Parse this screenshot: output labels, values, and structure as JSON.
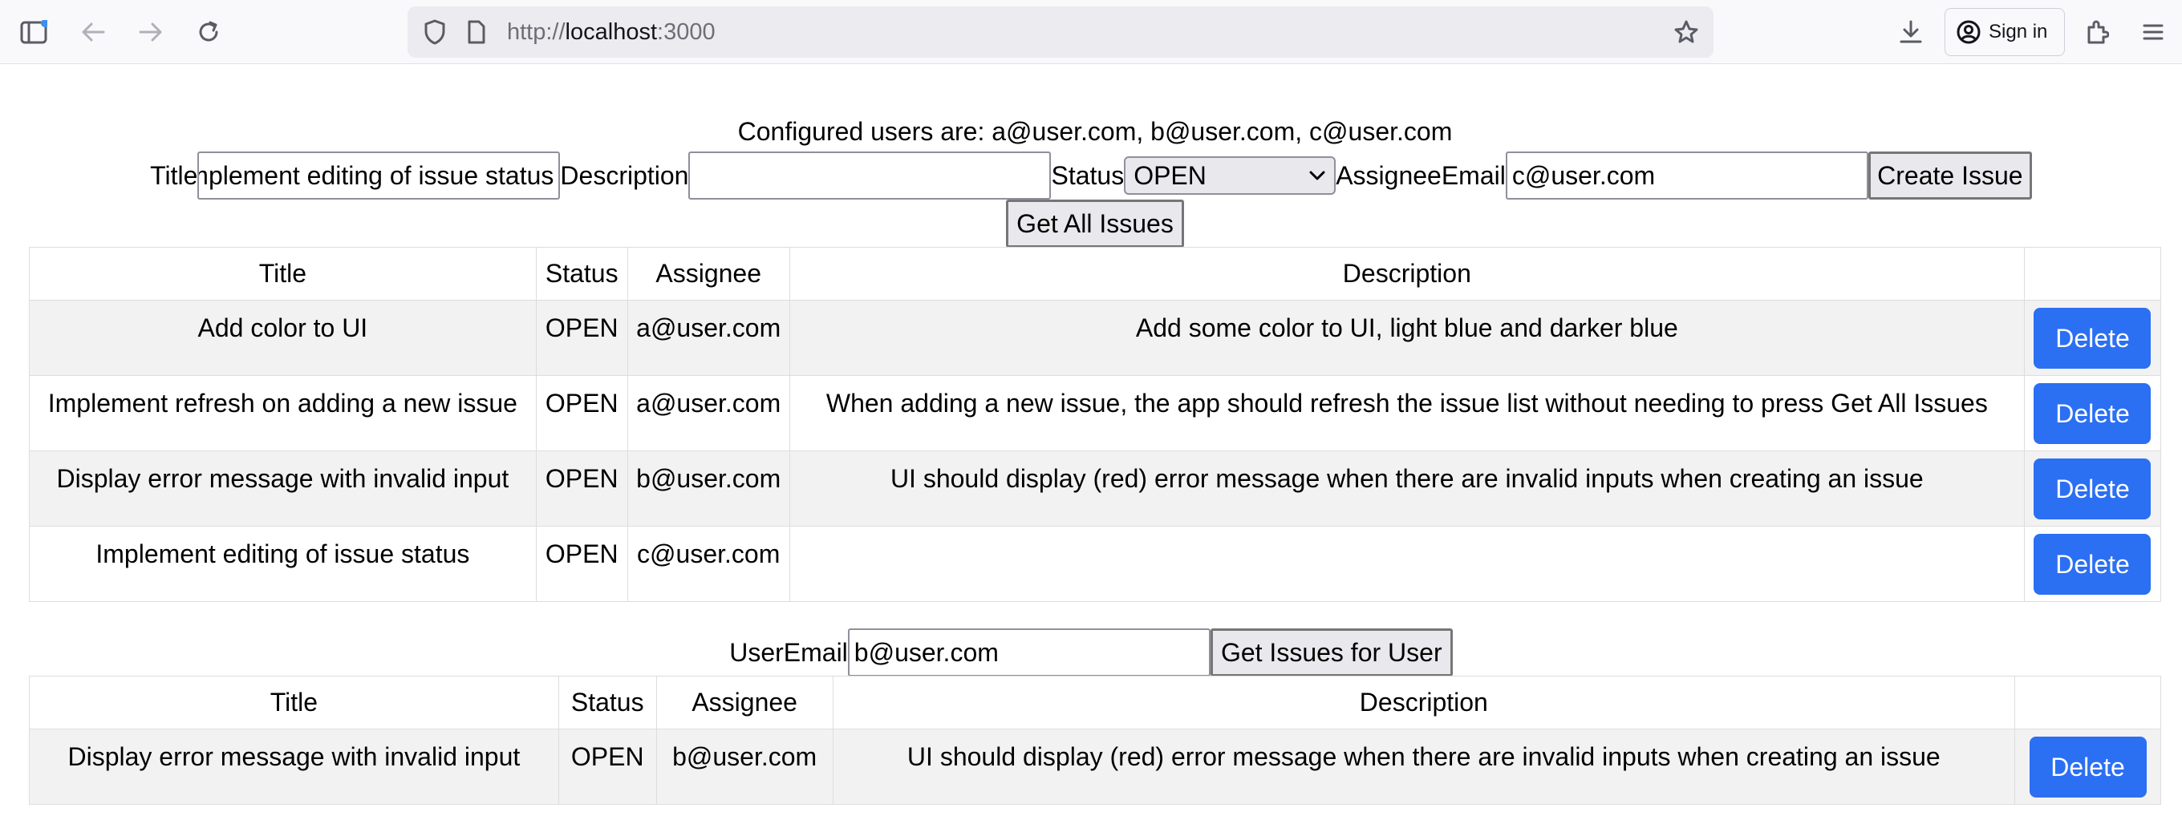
{
  "browser": {
    "url_prefix": "http://",
    "url_host": "localhost",
    "url_suffix": ":3000",
    "sign_in_label": "Sign in"
  },
  "configured_users_text": "Configured users are: a@user.com, b@user.com, c@user.com",
  "create_form": {
    "title_label": "Title",
    "title_value": "Implement editing of issue status",
    "description_label": "Description",
    "description_value": "",
    "status_label": "Status",
    "status_value": "OPEN",
    "assignee_label": "AssigneeEmail",
    "assignee_value": "c@user.com",
    "create_button": "Create Issue",
    "get_all_button": "Get All Issues"
  },
  "all_issues": {
    "headers": [
      "Title",
      "Status",
      "Assignee",
      "Description",
      ""
    ],
    "rows": [
      {
        "title": "Add color to UI",
        "status": "OPEN",
        "assignee": "a@user.com",
        "description": "Add some color to UI, light blue and darker blue",
        "action": "Delete"
      },
      {
        "title": "Implement refresh on adding a new issue",
        "status": "OPEN",
        "assignee": "a@user.com",
        "description": "When adding a new issue, the app should refresh the issue list without needing to press Get All Issues",
        "action": "Delete"
      },
      {
        "title": "Display error message with invalid input",
        "status": "OPEN",
        "assignee": "b@user.com",
        "description": "UI should display (red) error message when there are invalid inputs when creating an issue",
        "action": "Delete"
      },
      {
        "title": "Implement editing of issue status",
        "status": "OPEN",
        "assignee": "c@user.com",
        "description": "",
        "action": "Delete"
      }
    ]
  },
  "user_form": {
    "email_label": "UserEmail",
    "email_value": "b@user.com",
    "button": "Get Issues for User"
  },
  "user_issues": {
    "headers": [
      "Title",
      "Status",
      "Assignee",
      "Description",
      ""
    ],
    "rows": [
      {
        "title": "Display error message with invalid input",
        "status": "OPEN",
        "assignee": "b@user.com",
        "description": "UI should display (red) error message when there are invalid inputs when creating an issue",
        "action": "Delete"
      }
    ]
  },
  "colors": {
    "delete_button": "#2b6ff3",
    "row_stripe": "#f2f2f2"
  }
}
